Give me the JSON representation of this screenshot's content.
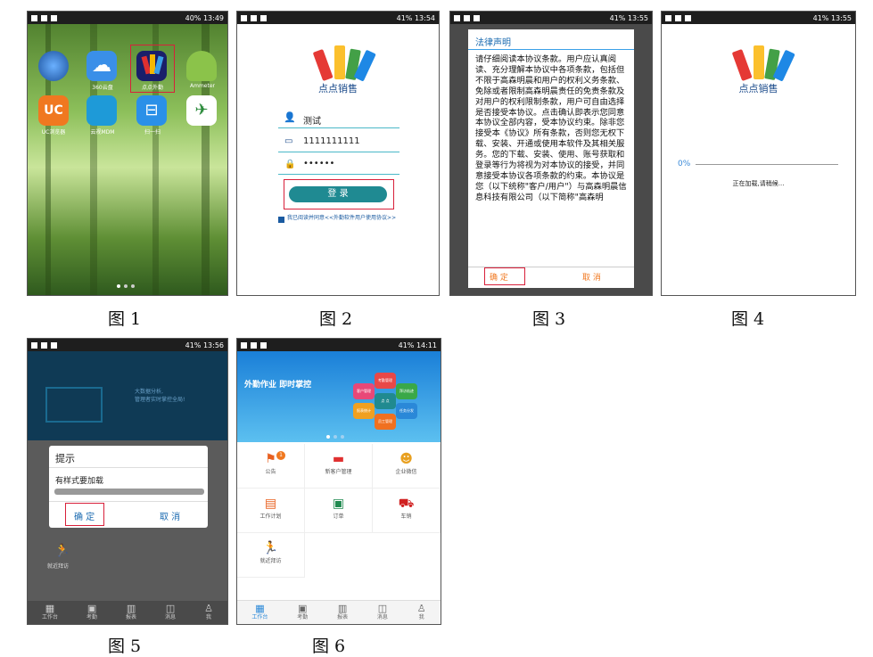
{
  "captions": [
    "图 1",
    "图 2",
    "图 3",
    "图 4",
    "图 5",
    "图 6"
  ],
  "status": {
    "s1": {
      "battery": "40%",
      "time": "13:49"
    },
    "s2": {
      "battery": "41%",
      "time": "13:54"
    },
    "s3": {
      "battery": "41%",
      "time": "13:55"
    },
    "s4": {
      "battery": "41%",
      "time": "13:55"
    },
    "s5": {
      "battery": "41%",
      "time": "13:56"
    },
    "s6": {
      "battery": "41%",
      "time": "14:11"
    }
  },
  "home": {
    "apps": [
      {
        "label": "",
        "icon": "globe-icon"
      },
      {
        "label": "360云盘",
        "icon": "cloud-icon"
      },
      {
        "label": "点点外勤",
        "icon": "app-logo-icon"
      },
      {
        "label": "Ammeter",
        "icon": "android-icon"
      },
      {
        "label": "UC浏览器",
        "icon": "uc-icon"
      },
      {
        "label": "云视MDM",
        "icon": "mdm-icon"
      },
      {
        "label": "扫一扫",
        "icon": "scan-icon"
      },
      {
        "label": "",
        "icon": "plane-icon"
      }
    ]
  },
  "login": {
    "app_name": "点点销售",
    "username": "测试",
    "phone": "1111111111",
    "password": "••••••",
    "login_button": "登  录",
    "agree_text": "我已阅读并同意<<外勤软件用户使用协议>>"
  },
  "legal": {
    "title": "法律声明",
    "body": "请仔细阅读本协议条款。用户应认真阅读、充分理解本协议中各项条款，包括但不限于高森明晨和用户的权利义务条款、免除或者限制高森明晨责任的免责条款及对用户的权利限制条款，用户可自由选择是否接受本协议。点击确认即表示您同意本协议全部内容，受本协议约束。除非您接受本《协议》所有条款，否则您无权下载、安装、开通或使用本软件及其相关服务。您的下载、安装、使用、账号获取和登录等行为将视为对本协议的接受，并同意接受本协议各项条款的约束。本协议是您（以下统称\"客户/用户\"）与高森明晨信息科技有限公司（以下简称\"高森明",
    "confirm": "确 定",
    "cancel": "取 消"
  },
  "loading": {
    "app_name": "点点销售",
    "percent": "0%",
    "progress": 0,
    "message": "正在加载,请稍候..."
  },
  "prompt": {
    "banner_line1": "大数据分析,",
    "banner_line2": "管理者实时掌控全局!",
    "title": "提示",
    "message": "有样式要加载",
    "confirm": "确 定",
    "cancel": "取 消",
    "visit_label": "就近拜访"
  },
  "dashboard": {
    "banner_title": "外勤作业 即时掌控",
    "hexes": [
      "考勤管理",
      "拜访轨迹",
      "客户管理",
      "任务分发",
      "报表统计",
      "员工管理",
      "点 点"
    ],
    "badge": "1",
    "cells": [
      {
        "label": "公告",
        "icon": "announcement-icon"
      },
      {
        "label": "新客户管理",
        "icon": "new-customer-icon"
      },
      {
        "label": "企业微信",
        "icon": "wechat-icon"
      },
      {
        "label": "工作计划",
        "icon": "plan-icon"
      },
      {
        "label": "订单",
        "icon": "order-icon"
      },
      {
        "label": "车销",
        "icon": "car-icon"
      },
      {
        "label": "就近拜访",
        "icon": "walk-icon"
      }
    ]
  },
  "tabs": [
    "工作台",
    "考勤",
    "报表",
    "消息",
    "我"
  ]
}
